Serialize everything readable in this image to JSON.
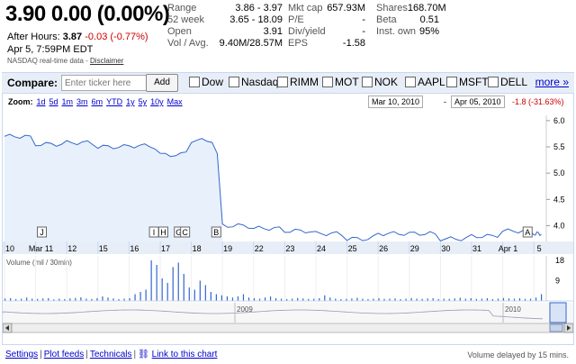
{
  "quote": {
    "price": "3.90",
    "change": "0.00 (0.00%)"
  },
  "after_hours": {
    "label": "After Hours:",
    "price": "3.87",
    "change": "-0.03 (-0.77%)"
  },
  "as_of": "Apr 5, 7:59PM EDT",
  "nasdaq_note": "NASDAQ real-time data - ",
  "disclaimer": "Disclaimer",
  "stats_col1": [
    {
      "label": "Range",
      "value": "3.86 - 3.97"
    },
    {
      "label": "52 week",
      "value": "3.65 - 18.09"
    },
    {
      "label": "Open",
      "value": "3.91"
    },
    {
      "label": "Vol / Avg.",
      "value": "9.40M/28.57M"
    }
  ],
  "stats_col2": [
    {
      "label": "Mkt cap",
      "value": "657.93M"
    },
    {
      "label": "P/E",
      "value": "-"
    },
    {
      "label": "Div/yield",
      "value": "-"
    },
    {
      "label": "EPS",
      "value": "-1.58"
    }
  ],
  "stats_col3": [
    {
      "label": "Shares",
      "value": "168.70M"
    },
    {
      "label": "Beta",
      "value": "0.51"
    },
    {
      "label": "Inst. own",
      "value": "95%"
    }
  ],
  "compare": {
    "label": "Compare:",
    "placeholder": "Enter ticker here",
    "add": "Add",
    "tickers": [
      "Dow",
      "Nasdaq",
      "RIMM",
      "MOT",
      "NOK",
      "AAPL",
      "MSFT",
      "DELL"
    ],
    "more": "more »"
  },
  "zoom": {
    "label": "Zoom:",
    "options": [
      "1d",
      "5d",
      "1m",
      "3m",
      "6m",
      "YTD",
      "1y",
      "5y",
      "10y",
      "Max"
    ]
  },
  "range": {
    "from": "Mar 10, 2010",
    "dash": "-",
    "to": "Apr 05, 2010",
    "change": "-1.8 (-31.63%)"
  },
  "colors": {
    "line": "#3366cc",
    "fill": "#e8f0fb",
    "neg": "#cc0000",
    "link": "#0000cc",
    "volume": "#3366cc"
  },
  "chart_data": {
    "type": "line",
    "x": [
      "Mar 10",
      "Mar 11",
      "Mar 12",
      "Mar 15",
      "Mar 16",
      "Mar 17",
      "Mar 18",
      "Mar 19",
      "Mar 22",
      "Mar 23",
      "Mar 24",
      "Mar 25",
      "Mar 26",
      "Mar 29",
      "Mar 30",
      "Mar 31",
      "Apr 1",
      "Apr 5"
    ],
    "y": [
      5.7,
      5.55,
      5.58,
      5.5,
      5.52,
      5.35,
      5.62,
      4.0,
      3.95,
      3.9,
      3.85,
      3.75,
      3.85,
      3.85,
      3.75,
      3.8,
      3.9,
      3.85
    ],
    "ylim": [
      3.7,
      6.1
    ],
    "yticks": [
      "6.0",
      "5.5",
      "5.0",
      "4.5",
      "4.0"
    ],
    "xticks": [
      "10",
      "Mar 11",
      "12",
      "15",
      "16",
      "17",
      "18",
      "19",
      "22",
      "23",
      "24",
      "25",
      "26",
      "29",
      "30",
      "31",
      "Apr 1",
      "5"
    ],
    "markers": [
      "J",
      "I",
      "H",
      "G",
      "C",
      "B",
      "A"
    ],
    "volume_label": "Volume (mil / 30min)",
    "volume_ticks": [
      "18",
      "9"
    ],
    "volume": [
      1,
      1.2,
      0.8,
      1,
      1.5,
      1,
      0.9,
      1.1,
      1.2,
      0.7,
      1,
      0.8,
      1.1,
      1.3,
      1.6,
      1,
      0.9,
      1.2,
      2,
      1.5,
      1.1,
      0.8,
      1,
      1.2,
      3,
      4,
      5,
      18,
      16,
      10,
      8,
      15,
      17,
      12,
      6,
      5,
      9,
      7,
      4,
      3,
      2.5,
      2,
      1.5,
      2,
      3,
      1.5,
      1.2,
      1,
      1.5,
      2,
      1.2,
      1,
      0.8,
      1,
      1.3,
      1.1,
      0.9,
      1,
      1.2,
      2.5,
      1.5,
      1,
      0.8,
      0.9,
      1.1,
      1.4,
      1,
      0.8,
      1,
      1.2,
      0.9,
      1,
      1.1,
      0.8,
      1,
      1.3,
      1,
      0.9,
      1.1,
      1.2,
      0.8,
      1,
      0.9,
      1.1,
      1.4,
      1,
      1.2,
      0.9,
      1,
      1.2,
      0.8,
      1,
      1.3,
      1.1,
      1,
      1.2,
      0.9,
      1,
      1.5,
      3
    ],
    "overview_labels": [
      "2009",
      "2010"
    ]
  },
  "footer": {
    "settings": "Settings",
    "plot_feeds": "Plot feeds",
    "technicals": "Technicals",
    "link": "Link to this chart",
    "delay": "Volume delayed by 15 mins."
  }
}
